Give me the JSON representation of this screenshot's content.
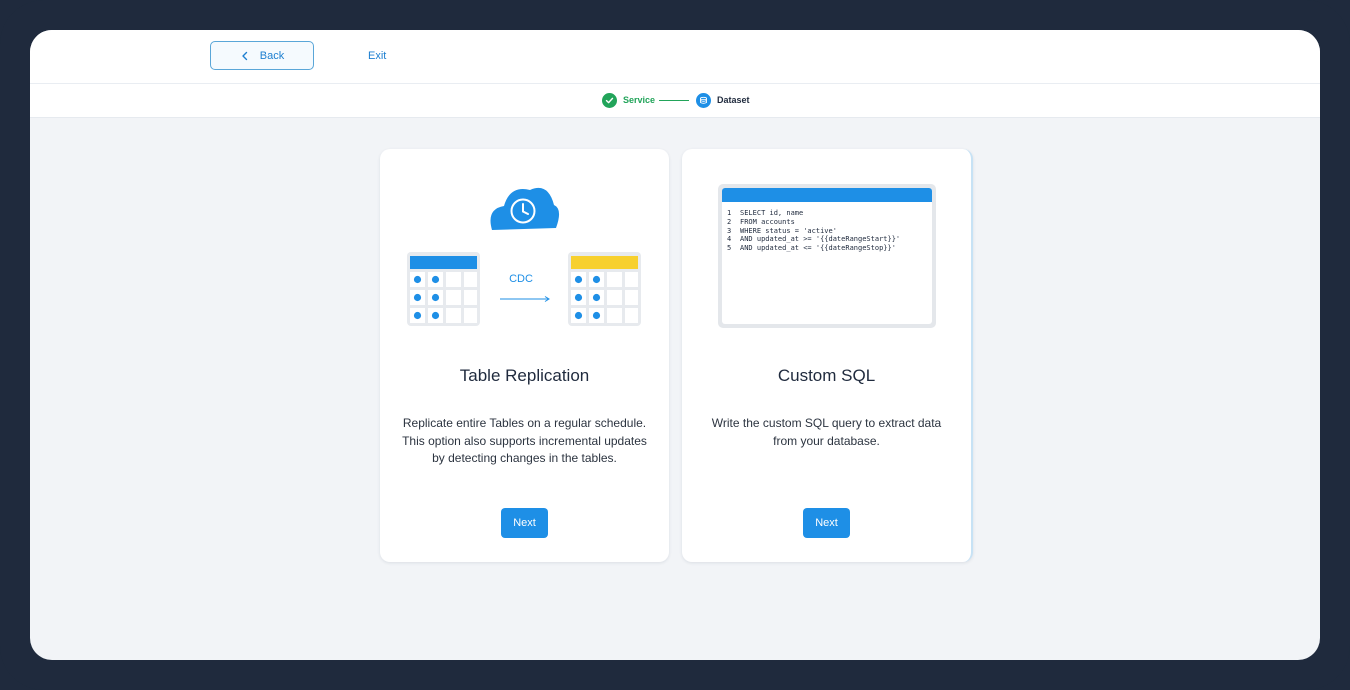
{
  "header": {
    "back_label": "Back",
    "exit_label": "Exit"
  },
  "stepper": {
    "steps": [
      {
        "label": "Service",
        "status": "complete",
        "color": "#22a45a"
      },
      {
        "label": "Dataset",
        "status": "active",
        "color": "#1e8fe6"
      }
    ]
  },
  "cards": [
    {
      "title": "Table Replication",
      "description": "Replicate entire Tables on a regular schedule. This option also supports incremental updates by detecting changes in the tables.",
      "illustration": {
        "icon": "cloud-clock-icon",
        "arrow_label": "CDC"
      },
      "button_label": "Next"
    },
    {
      "title": "Custom SQL",
      "description": "Write the custom SQL query to extract data from your database.",
      "sql_lines": [
        {
          "num": "1",
          "code": "SELECT id, name"
        },
        {
          "num": "2",
          "code": "FROM accounts"
        },
        {
          "num": "3",
          "code": "WHERE status = 'active'"
        },
        {
          "num": "4",
          "code": "AND updated_at >= '{{dateRangeStart}}'"
        },
        {
          "num": "5",
          "code": "AND updated_at <= '{{dateRangeStop}}'"
        }
      ],
      "button_label": "Next"
    }
  ],
  "colors": {
    "accent": "#1e8fe6",
    "success": "#22a45a",
    "target_table_header": "#f7d02e",
    "frame": "#1f2a3d"
  }
}
